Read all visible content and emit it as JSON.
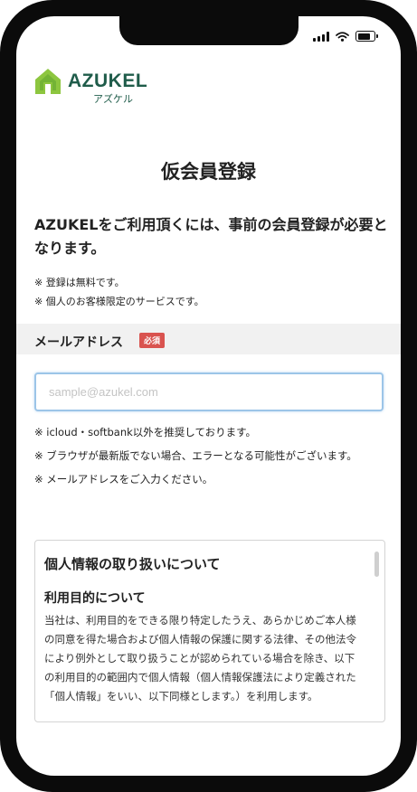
{
  "brand": {
    "name": "AZUKEL",
    "kana": "アズケル",
    "color": "#1f5c4a",
    "icon_color": "#8dc63f"
  },
  "page": {
    "title": "仮会員登録",
    "lead": "AZUKELをご利用頂くには、事前の会員登録が必要となります。",
    "notes": [
      "※ 登録は無料です。",
      "※ 個人のお客様限定のサービスです。"
    ]
  },
  "email": {
    "label": "メールアドレス",
    "required_badge": "必須",
    "placeholder": "sample@azukel.com",
    "value": "",
    "notes": [
      "※ icloud・softbank以外を推奨しております。",
      "※ ブラウザが最新版でない場合、エラーとなる可能性がございます。",
      "※ メールアドレスをご入力ください。"
    ]
  },
  "privacy": {
    "heading": "個人情報の取り扱いについて",
    "subheading": "利用目的について",
    "body": "当社は、利用目的をできる限り特定したうえ、あらかじめご本人様の同意を得た場合および個人情報の保護に関する法律、その他法令により例外として取り扱うことが認められている場合を除き、以下の利用目的の範囲内で個人情報（個人情報保護法により定義された「個人情報」をいい、以下同様とします。）を利用します。"
  },
  "status_bar": {
    "icons": [
      "signal-icon",
      "wifi-icon",
      "battery-icon"
    ]
  },
  "colors": {
    "required": "#d9534f",
    "input_focus": "#9cc5e8",
    "band": "#f1f1f1"
  }
}
